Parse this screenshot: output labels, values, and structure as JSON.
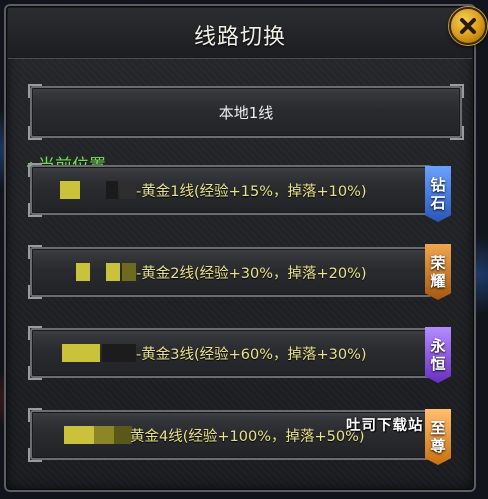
{
  "window": {
    "title": "线路切换",
    "close_icon": "close-icon"
  },
  "current_line": "本地1线",
  "current_position_label": "当前位置",
  "lines": [
    {
      "dash": "-",
      "label": "黄金1线(经验+15%，掉落+10%)",
      "tag": [
        "钻",
        "石"
      ],
      "tag_color": "#3f6fd1"
    },
    {
      "dash": "-",
      "label": "黄金2线(经验+30%，掉落+20%)",
      "tag": [
        "荣",
        "耀"
      ],
      "tag_color": "#c8781a"
    },
    {
      "dash": "-",
      "label": "黄金3线(经验+60%，掉落+30%)",
      "tag": [
        "永",
        "恒"
      ],
      "tag_color": "#8a4fd6"
    },
    {
      "dash": "",
      "label": "黄金4线(经验+100%，掉落+50%)",
      "tag": [
        "至",
        "尊"
      ],
      "tag_color": "#d8892a"
    }
  ],
  "watermark": "吐司下载站",
  "colors": {
    "row_text": "#e8e28a",
    "current_pos": "#7fd66a",
    "mosaic_yellow": "#c9c23a"
  }
}
